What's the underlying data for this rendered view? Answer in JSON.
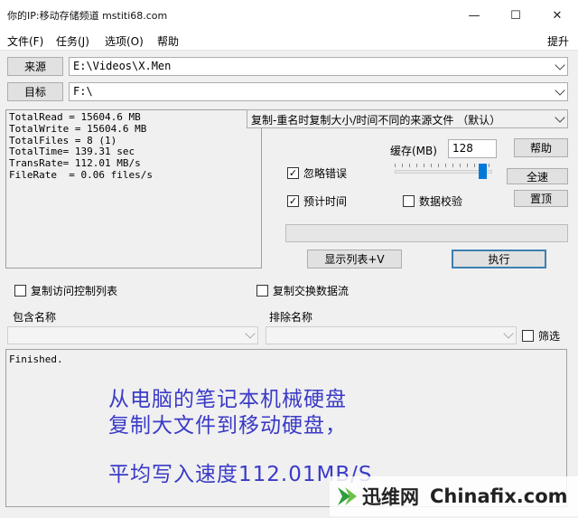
{
  "window": {
    "title": "你的IP:移动存储频道 mstiti68.com",
    "controls": {
      "minimize": "—",
      "maximize": "☐",
      "close": "✕"
    }
  },
  "menu": {
    "items": [
      "文件(F)",
      "任务(J)",
      "选项(O)",
      "帮助"
    ],
    "right": "提升"
  },
  "source": {
    "label": "来源",
    "value": "E:\\Videos\\X.Men"
  },
  "target": {
    "label": "目标",
    "value": "F:\\"
  },
  "stats": [
    "TotalRead = 15604.6 MB",
    "TotalWrite = 15604.6 MB",
    "TotalFiles = 8 (1)",
    "TotalTime= 139.31 sec",
    "TransRate= 112.01 MB/s",
    "FileRate  = 0.06 files/s"
  ],
  "mode": {
    "selected": "复制-重名时复制大小/时间不同的来源文件 （默认）"
  },
  "buffer": {
    "label": "缓存(MB)",
    "value": "128",
    "slider_fraction": 0.88
  },
  "buttons": {
    "help": "帮助",
    "full_speed": "全速",
    "top": "置顶",
    "show_list": "显示列表+V",
    "execute": "执行"
  },
  "checks": {
    "ignore_errors": {
      "label": "忽略错误",
      "checked": true
    },
    "estimate_time": {
      "label": "预计时间",
      "checked": true
    },
    "verify": {
      "label": "数据校验",
      "checked": false
    },
    "copy_acl": {
      "label": "复制访问控制列表",
      "checked": false
    },
    "copy_streams": {
      "label": "复制交换数据流",
      "checked": false
    },
    "filter": {
      "label": "筛选",
      "checked": false
    }
  },
  "include": {
    "label": "包含名称",
    "value": ""
  },
  "exclude": {
    "label": "排除名称",
    "value": ""
  },
  "log": {
    "text": "Finished."
  },
  "overlay": {
    "line1": "从电脑的笔记本机械硬盘",
    "line2": "复制大文件到移动硬盘，",
    "line3": "平均写入速度112.01MB/S"
  },
  "watermark": {
    "cn": "迅维网",
    "en": "Chinafix.com",
    "logo_color": "#2e9d3c"
  }
}
